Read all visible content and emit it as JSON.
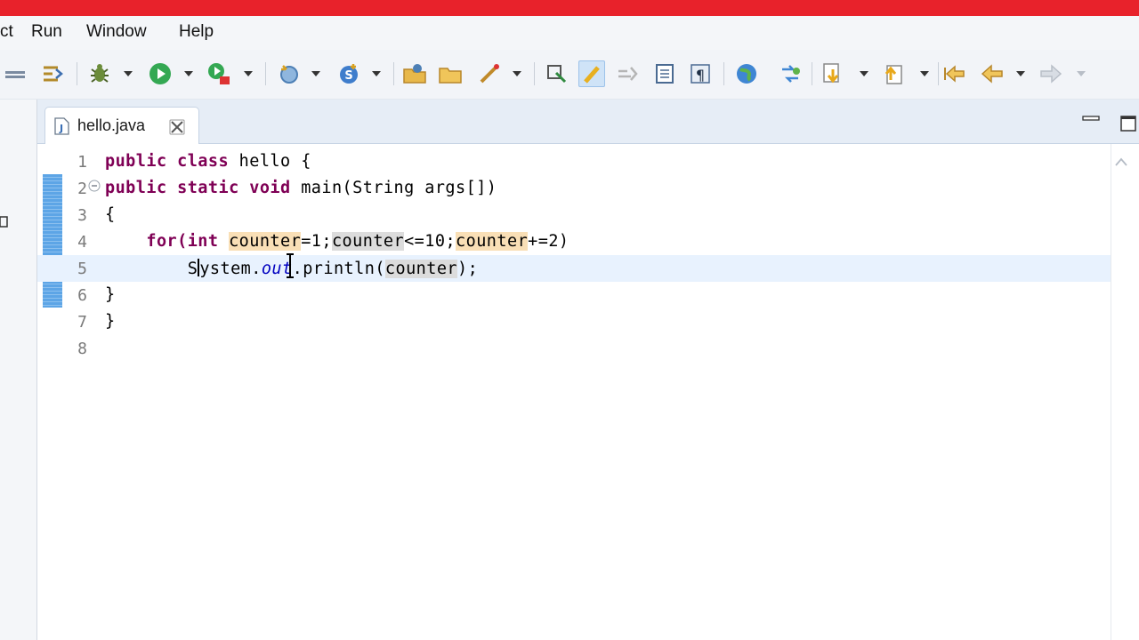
{
  "menubar": {
    "items": [
      {
        "label": "ct"
      },
      {
        "label": "Run"
      },
      {
        "label": "Window"
      },
      {
        "label": "Help"
      }
    ]
  },
  "toolbar": {
    "buttons": [
      "skip-breakpoints-icon",
      "step-filters-icon",
      "debug-icon",
      "run-icon",
      "run-external-tools-icon",
      "new-java-package-icon",
      "new-java-class-icon",
      "open-type-icon",
      "open-folder-icon",
      "annotations-icon",
      "toggle-mark-occurrences-icon",
      "toggle-highlight-icon",
      "breadcrumb-icon",
      "block-selection-icon",
      "show-whitespace-icon",
      "web-browser-icon",
      "toggle-ant-icon",
      "next-annotation-icon",
      "previous-annotation-icon",
      "last-edit-location-icon",
      "back-icon",
      "forward-icon"
    ]
  },
  "editor": {
    "tab": {
      "label": "hello.java",
      "icon": "java-file-icon",
      "close_icon": "close-icon"
    },
    "lines": [
      {
        "number": "1",
        "text": "public class hello {"
      },
      {
        "number": "2",
        "text": "public static void main(String args[])"
      },
      {
        "number": "3",
        "text": "{"
      },
      {
        "number": "4",
        "text": "    for(int counter=1;counter<=10;counter+=2)"
      },
      {
        "number": "5",
        "text": "        System.out.println(counter);"
      },
      {
        "number": "6",
        "text": "}"
      },
      {
        "number": "7",
        "text": "}"
      },
      {
        "number": "8",
        "text": ""
      }
    ],
    "tokens": {
      "kw_public": "public",
      "kw_class": "class",
      "class_name": " hello {",
      "kw_static": "static",
      "kw_void": "void",
      "main_sig": " main(String args[])",
      "open_brace": "{",
      "close_brace": "}",
      "kw_for": "for(",
      "kw_int": "int",
      "counter": "counter",
      "init": "=1;",
      "cond": "<=10;",
      "incr": "+=2)",
      "system_s": "S",
      "system_rest": "ystem.",
      "out": "out",
      "println": ".println(",
      "end_stmt": ");"
    },
    "current_line": 5
  },
  "colors": {
    "title_bar": "#e8222b",
    "keyword": "#7f0055",
    "field": "#0000c0",
    "occurrence_write": "#f9dfb6",
    "occurrence_read": "#dcdcdc",
    "current_line": "#e8f2fe",
    "change_bar": "#5da5e6"
  }
}
